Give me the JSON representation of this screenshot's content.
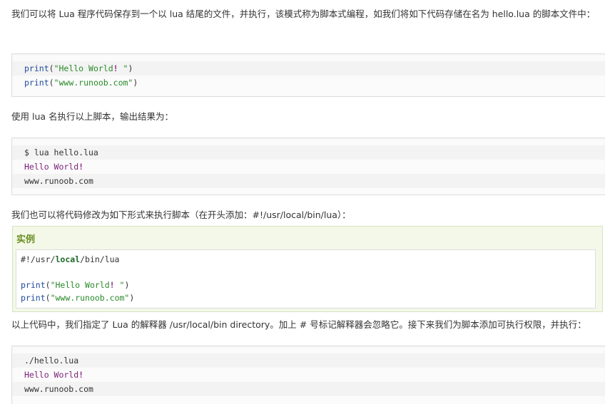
{
  "para1": "我们可以将 Lua 程序代码保存到一个以 lua 结尾的文件，并执行，该模式称为脚本式编程，如我们将如下代码存储在名为 hello.lua 的脚本文件中：",
  "block1": {
    "line1": {
      "fn": "print",
      "open": "(",
      "str": "\"Hello World",
      "bang": "!",
      "str2": " \"",
      "close": ")"
    },
    "line2": {
      "fn": "print",
      "open": "(",
      "str": "\"www.runoob.com\"",
      "close": ")"
    }
  },
  "para2": "使用 lua 名执行以上脚本，输出结果为：",
  "block2": {
    "line1": "$ lua hello.lua",
    "line2": {
      "text": "Hello World",
      "bang": "!"
    },
    "line3": "www.runoob.com"
  },
  "para3": "我们也可以将代码修改为如下形式来执行脚本（在开头添加：#!/usr/local/bin/lua）：",
  "example": {
    "title": "实例",
    "line1": {
      "pre": "#!/usr/",
      "kw": "local",
      "post": "/bin/lua"
    },
    "line3": {
      "fn": "print",
      "open": "(",
      "str": "\"Hello World",
      "bang": "!",
      "str2": " \"",
      "close": ")"
    },
    "line4": {
      "fn": "print",
      "open": "(",
      "str": "\"www.runoob.com\"",
      "close": ")"
    }
  },
  "para4": "以上代码中，我们指定了 Lua 的解释器 /usr/local/bin directory。加上 # 号标记解释器会忽略它。接下来我们为脚本添加可执行权限，并执行：",
  "block3": {
    "line1": "./hello.lua",
    "line2": {
      "text": "Hello World",
      "bang": "!"
    },
    "line3": "www.runoob.com"
  }
}
